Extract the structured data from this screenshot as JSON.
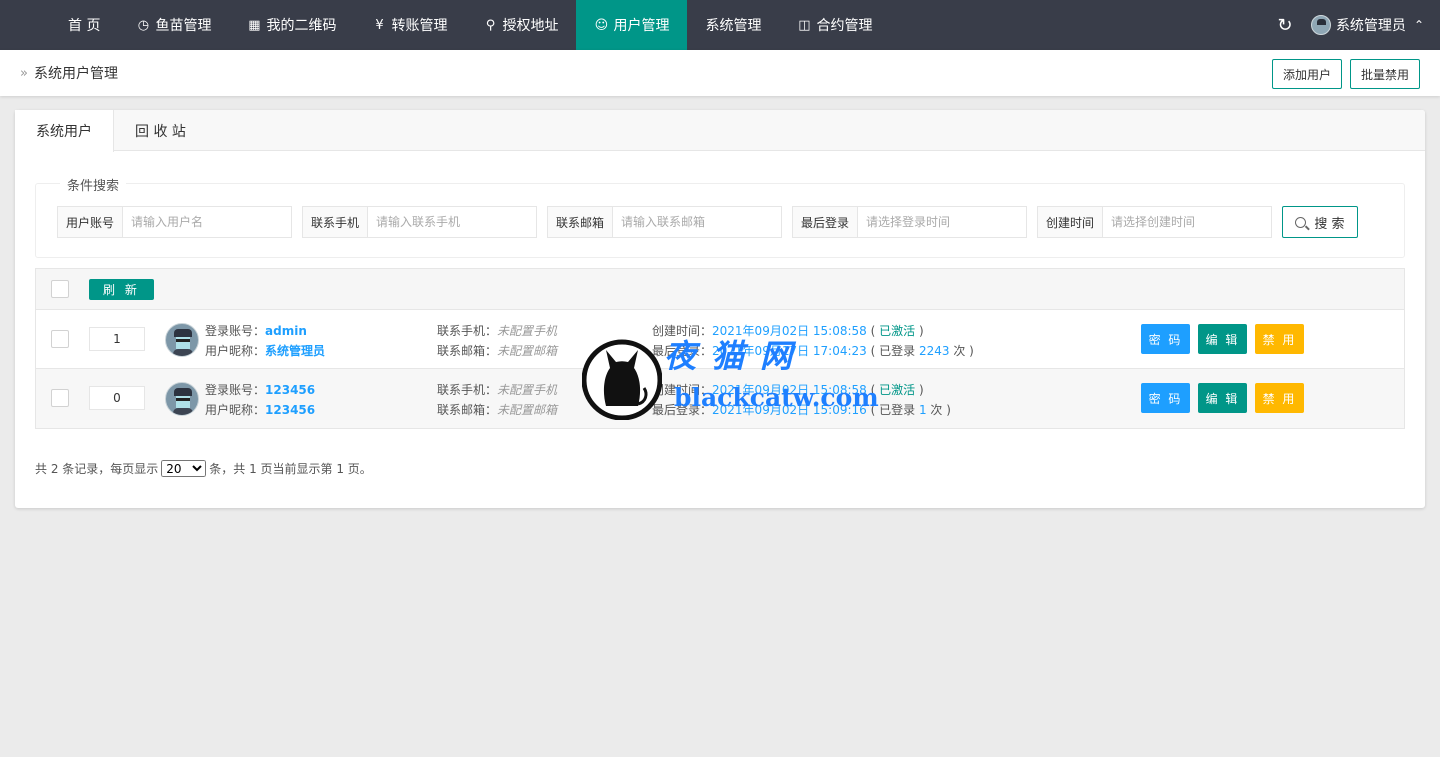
{
  "nav": {
    "items": [
      {
        "label": "首 页",
        "icon": "none"
      },
      {
        "label": "鱼苗管理",
        "icon": "timer-icon"
      },
      {
        "label": "我的二维码",
        "icon": "qrcode-icon"
      },
      {
        "label": "转账管理",
        "icon": "yen-icon"
      },
      {
        "label": "授权地址",
        "icon": "location-icon"
      },
      {
        "label": "用户管理",
        "icon": "user-icon"
      },
      {
        "label": "系统管理",
        "icon": "none"
      },
      {
        "label": "合约管理",
        "icon": "columns-icon"
      }
    ],
    "active_index": 5,
    "user": "系统管理员",
    "active_color": "#009688",
    "bar_color": "#393d49"
  },
  "breadcrumb": "系统用户管理",
  "actions": {
    "add_user": "添加用户",
    "batch_disable": "批量禁用"
  },
  "tabs": [
    "系统用户",
    "回 收 站"
  ],
  "search": {
    "legend": "条件搜索",
    "fields": [
      {
        "label": "用户账号",
        "placeholder": "请输入用户名"
      },
      {
        "label": "联系手机",
        "placeholder": "请输入联系手机"
      },
      {
        "label": "联系邮箱",
        "placeholder": "请输入联系邮箱"
      },
      {
        "label": "最后登录",
        "placeholder": "请选择登录时间"
      },
      {
        "label": "创建时间",
        "placeholder": "请选择创建时间"
      }
    ],
    "button": "搜 索"
  },
  "table": {
    "refresh": "刷 新",
    "rows": [
      {
        "sort": "1",
        "account_label": "登录账号：",
        "account": "admin",
        "nick_label": "用户昵称：",
        "nick": "系统管理员",
        "phone_label": "联系手机：",
        "phone": "未配置手机",
        "email_label": "联系邮箱：",
        "email": "未配置邮箱",
        "created_label": "创建时间：",
        "created": "2021年09月02日 15:08:58",
        "status_open": " ( ",
        "status": "已激活",
        "status_close": " )",
        "last_label": "最后登录：",
        "last": "2021年09月17日 17:04:23",
        "count_prefix": " ( 已登录 ",
        "count": "2243",
        "count_suffix": " 次 )"
      },
      {
        "sort": "0",
        "account_label": "登录账号：",
        "account": "123456",
        "nick_label": "用户昵称：",
        "nick": "123456",
        "phone_label": "联系手机：",
        "phone": "未配置手机",
        "email_label": "联系邮箱：",
        "email": "未配置邮箱",
        "created_label": "创建时间：",
        "created": "2021年09月02日 15:08:58",
        "status_open": " ( ",
        "status": "已激活",
        "status_close": " )",
        "last_label": "最后登录：",
        "last": "2021年09月02日 15:09:16",
        "count_prefix": " ( 已登录 ",
        "count": "1",
        "count_suffix": " 次 )"
      }
    ],
    "buttons": {
      "password": "密 码",
      "edit": "编 辑",
      "disable": "禁 用"
    }
  },
  "pager": {
    "prefix": "共 2 条记录，每页显示",
    "page_size": "20",
    "suffix": "条，共 1 页当前显示第 1 页。"
  },
  "watermark": {
    "title": "夜猫网",
    "url": "blackcatw.com"
  }
}
